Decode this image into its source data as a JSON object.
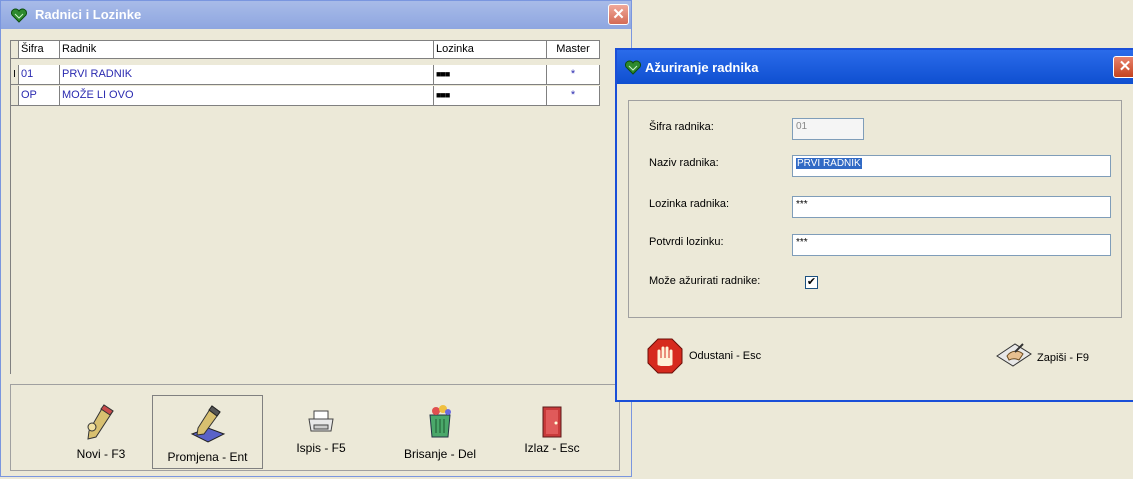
{
  "main_window": {
    "title": "Radnici i Lozinke",
    "close_glyph": "✕"
  },
  "grid": {
    "columns": [
      "Šifra",
      "Radnik",
      "Lozinka",
      "Master"
    ],
    "rows": [
      {
        "indicator": "I",
        "sifra": "01",
        "radnik": "PRVI RADNIK",
        "lozinka": "■■■",
        "master": "*"
      },
      {
        "indicator": "",
        "sifra": "OP",
        "radnik": "MOŽE LI OVO",
        "lozinka": "■■■",
        "master": "*"
      }
    ]
  },
  "toolbar": {
    "buttons": [
      {
        "label": "Novi - F3",
        "icon": "pencil-new-icon"
      },
      {
        "label": "Promjena - Ent",
        "icon": "pencil-edit-icon"
      },
      {
        "label": "Ispis - F5",
        "icon": "printer-icon"
      },
      {
        "label": "Brisanje - Del",
        "icon": "trash-can-icon"
      },
      {
        "label": "Izlaz - Esc",
        "icon": "exit-door-icon"
      }
    ]
  },
  "dialog": {
    "title": "Ažuriranje radnika",
    "close_glyph": "✕",
    "fields": {
      "sifra_label": "Šifra radnika:",
      "sifra_value": "01",
      "naziv_label": "Naziv radnika:",
      "naziv_value": "PRVI RADNIK",
      "lozinka_label": "Lozinka radnika:",
      "lozinka_value": "***",
      "potvrdi_label": "Potvrdi lozinku:",
      "potvrdi_value": "***",
      "master_label": "Može ažurirati radnike:",
      "master_checked": true,
      "check_glyph": "✔"
    },
    "cancel_label": "Odustani - Esc",
    "save_label": "Zapiši - F9"
  },
  "colors": {
    "grid_text": "#2a2ab0",
    "dialog_title": "#0f4fd0",
    "selection": "#316ac5"
  }
}
